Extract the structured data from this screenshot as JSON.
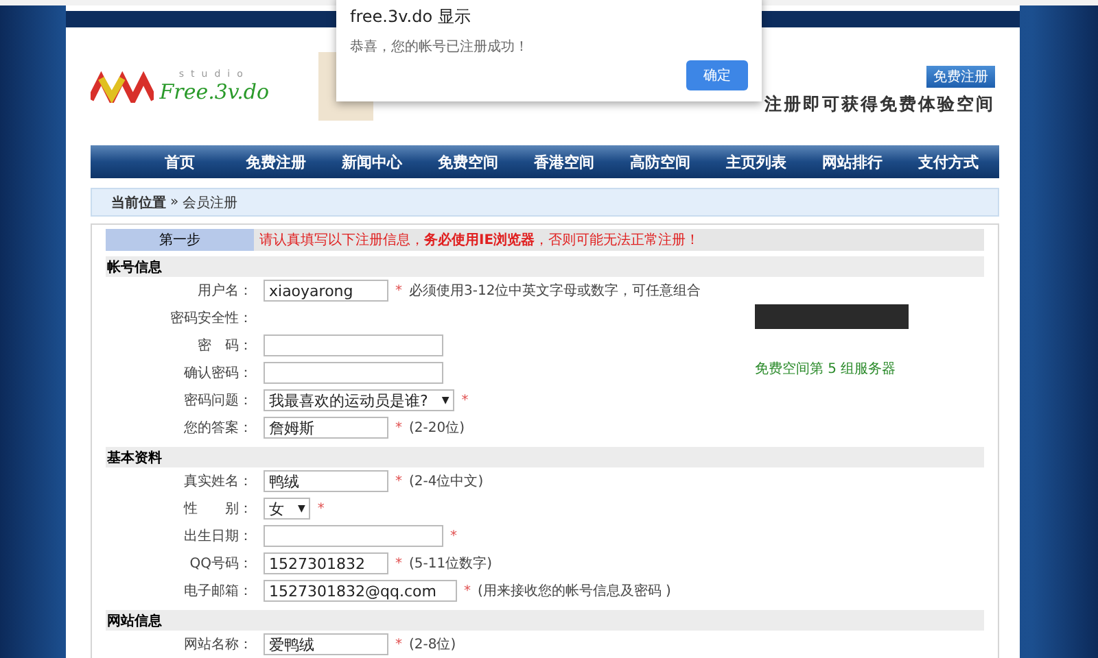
{
  "dialog": {
    "title": "free.3v.do 显示",
    "message": "恭喜，您的帐号已注册成功！",
    "button": "确定"
  },
  "header": {
    "register_button": "免费注册",
    "slogan": "注册即可获得免费体验空间",
    "logo_text": "Free.3v.do",
    "logo_sub": "studio"
  },
  "nav": [
    {
      "label": "首页"
    },
    {
      "label": "免费注册"
    },
    {
      "label": "新闻中心"
    },
    {
      "label": "免费空间"
    },
    {
      "label": "香港空间"
    },
    {
      "label": "高防空间"
    },
    {
      "label": "主页列表"
    },
    {
      "label": "网站排行"
    },
    {
      "label": "支付方式"
    }
  ],
  "breadcrumb": {
    "label": "当前位置",
    "separator": "»",
    "current": "会员注册"
  },
  "step": {
    "label": "第一步",
    "notice": "请认真填写以下注册信息，**务必使用IE浏览器**，否则可能无法正常注册！"
  },
  "sections": [
    {
      "title": "帐号信息",
      "rows": [
        {
          "label": "用户名：",
          "kind": "text",
          "value": "xiaoyarong",
          "mark": "*",
          "note": "必须使用3-12位中英文字母或数字，可任意组合"
        },
        {
          "label": "密码安全性：",
          "kind": "empty"
        },
        {
          "label": "密　码：",
          "kind": "text",
          "value": ""
        },
        {
          "label": "确认密码：",
          "kind": "text",
          "value": ""
        },
        {
          "label": "密码问题：",
          "kind": "select",
          "value": "我最喜欢的运动员是谁?",
          "caret": "▼",
          "mark": "*"
        },
        {
          "label": "您的答案：",
          "kind": "text",
          "value": "詹姆斯",
          "mark": "*",
          "note": "(2-20位)"
        }
      ]
    },
    {
      "title": "基本资料",
      "rows": [
        {
          "label": "真实姓名：",
          "kind": "text",
          "value": "鸭绒",
          "mark": "*",
          "note": "(2-4位中文)"
        },
        {
          "label": "性　　别：",
          "kind": "select",
          "value": "女",
          "caret": "▼",
          "mark": "*"
        },
        {
          "label": "出生日期：",
          "kind": "text",
          "value": "",
          "mark": "*"
        },
        {
          "label": "QQ号码：",
          "kind": "text",
          "value": "1527301832",
          "mark": "*",
          "note": "(5-11位数字)"
        },
        {
          "label": "电子邮箱：",
          "kind": "text",
          "value": "1527301832@qq.com",
          "mark": "*",
          "note": "(用来接收您的帐号信息及密码 )"
        }
      ]
    },
    {
      "title": "网站信息",
      "rows": [
        {
          "label": "网站名称：",
          "kind": "text",
          "value": "爱鸭绒",
          "mark": "*",
          "note": "(2-8位)"
        }
      ]
    }
  ],
  "server_caption": "免费空间第 5 组服务器"
}
